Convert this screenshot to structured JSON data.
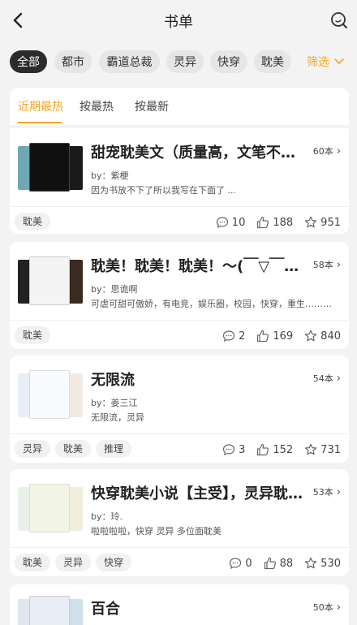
{
  "header": {
    "title": "书单"
  },
  "tags": [
    "全部",
    "都市",
    "霸道总裁",
    "灵异",
    "快穿",
    "耽美"
  ],
  "filter_label": "筛选",
  "sort_tabs": [
    "近期最热",
    "按最热",
    "按最新"
  ],
  "accent_color": "#f5a623",
  "cards": [
    {
      "title": "甜宠耽美文（质量高，文笔不错）",
      "count": "60本",
      "author": "by：紫梗",
      "desc": "因为书放不下了所以我写在下面了 ...",
      "chips": [
        "耽美"
      ],
      "comments": "10",
      "likes": "188",
      "stars": "951"
    },
    {
      "title": "耽美！耽美！耽美！～(￣▽￣～...",
      "count": "58本",
      "author": "by：思诡啊",
      "desc": "可虐可甜可傲娇，有电竞，娱乐圈，校园，快穿，重生……懒...",
      "chips": [
        "耽美"
      ],
      "comments": "2",
      "likes": "169",
      "stars": "840"
    },
    {
      "title": "无限流",
      "count": "54本",
      "author": "by：姜三江",
      "desc": "无限流，灵异",
      "chips": [
        "灵异",
        "耽美",
        "推理"
      ],
      "comments": "3",
      "likes": "152",
      "stars": "731"
    },
    {
      "title": "快穿耽美小说【主受】，灵异耽...",
      "count": "53本",
      "author": "by：玲.",
      "desc": "啦啦啦啦，快穿 灵异 多位面耽美",
      "chips": [
        "耽美",
        "灵异",
        "快穿"
      ],
      "comments": "0",
      "likes": "88",
      "stars": "530"
    },
    {
      "title": "百合",
      "count": "50本"
    }
  ]
}
